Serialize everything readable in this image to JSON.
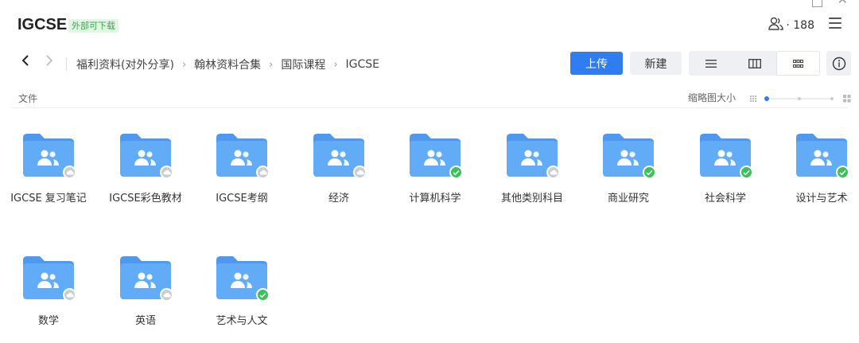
{
  "header": {
    "title": "IGCSE",
    "badge": "外部可下载",
    "member_count": "· 188"
  },
  "nav": {
    "breadcrumbs": [
      "福利资料(对外分享)",
      "翰林资料合集",
      "国际课程",
      "IGCSE"
    ]
  },
  "toolbar": {
    "upload_label": "上传",
    "new_label": "新建",
    "views": [
      "list-view",
      "column-view",
      "grid-view"
    ],
    "active_view": "grid-view"
  },
  "list": {
    "column_label": "文件",
    "thumb_size_label": "缩略图大小"
  },
  "colors": {
    "accent": "#2f7df0",
    "folder": "#5aa3f5",
    "synced": "#3cc05a",
    "cloud": "#c9ccd2"
  },
  "folders": [
    {
      "name": "IGCSE 复习笔记",
      "status": "cloud"
    },
    {
      "name": "IGCSE彩色教材",
      "status": "cloud"
    },
    {
      "name": "IGCSE考纲",
      "status": "cloud"
    },
    {
      "name": "经济",
      "status": "cloud"
    },
    {
      "name": "计算机科学",
      "status": "synced"
    },
    {
      "name": "其他类别科目",
      "status": "cloud"
    },
    {
      "name": "商业研究",
      "status": "synced"
    },
    {
      "name": "社会科学",
      "status": "synced"
    },
    {
      "name": "设计与艺术",
      "status": "synced"
    },
    {
      "name": "数学",
      "status": "cloud"
    },
    {
      "name": "英语",
      "status": "cloud"
    },
    {
      "name": "艺术与人文",
      "status": "synced"
    }
  ]
}
